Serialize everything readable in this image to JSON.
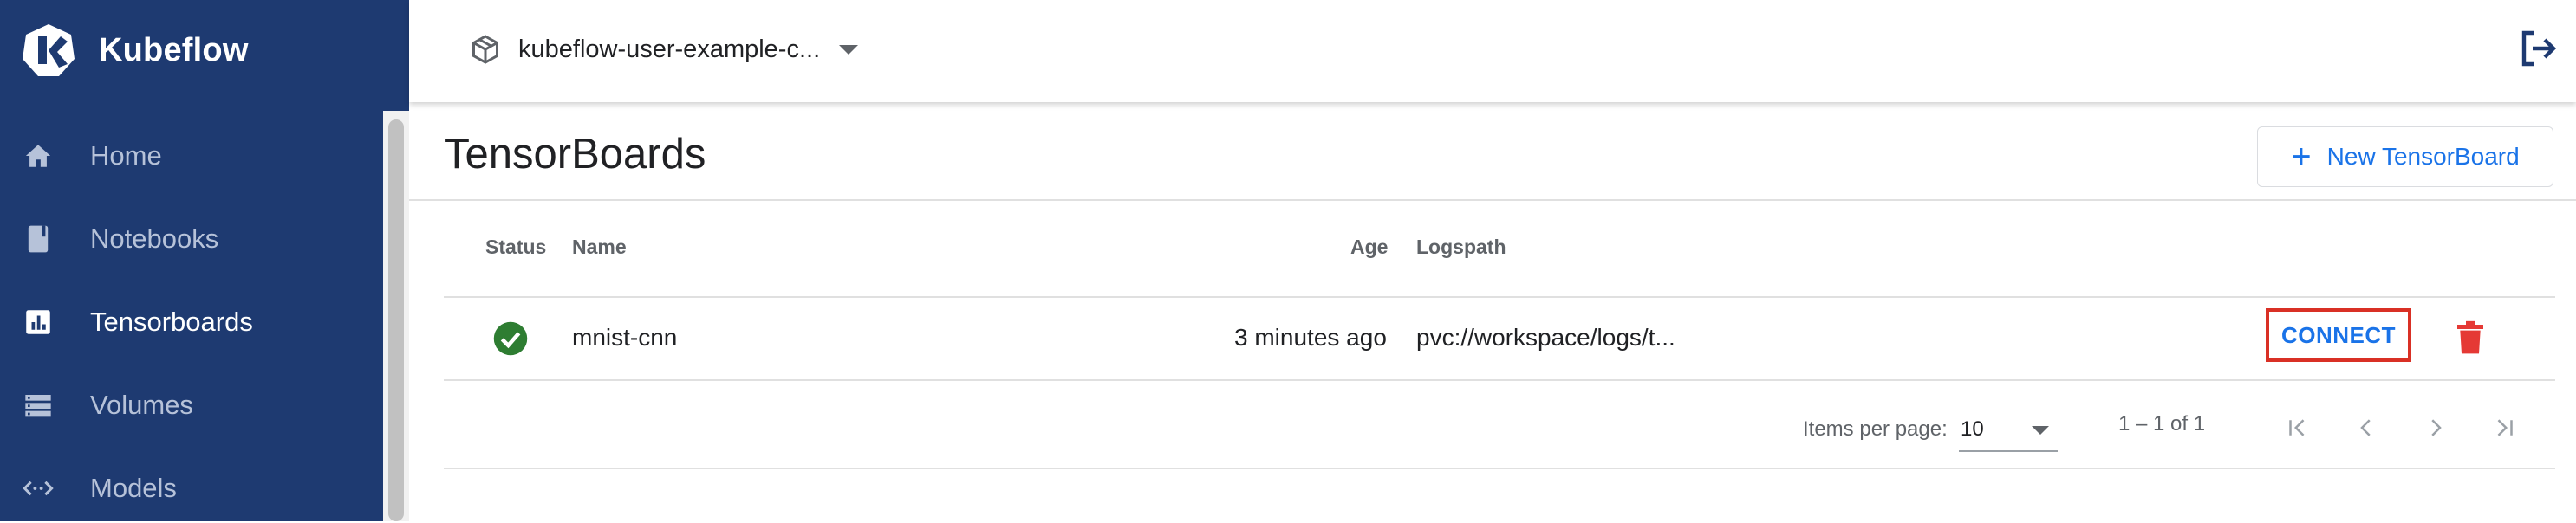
{
  "app": {
    "name": "Kubeflow"
  },
  "sidebar": {
    "items": [
      {
        "label": "Home",
        "icon": "home-icon",
        "active": false
      },
      {
        "label": "Notebooks",
        "icon": "notebook-icon",
        "active": false
      },
      {
        "label": "Tensorboards",
        "icon": "bar-chart-icon",
        "active": true
      },
      {
        "label": "Volumes",
        "icon": "storage-icon",
        "active": false
      },
      {
        "label": "Models",
        "icon": "code-arrows-icon",
        "active": false
      }
    ]
  },
  "topbar": {
    "namespace": "kubeflow-user-example-c...",
    "namespace_icon": "cube-icon",
    "logout_icon": "logout-icon"
  },
  "page": {
    "title": "TensorBoards",
    "new_button_label": "New TensorBoard"
  },
  "table": {
    "columns": {
      "status": "Status",
      "name": "Name",
      "age": "Age",
      "logspath": "Logspath"
    },
    "rows": [
      {
        "status": "ready",
        "name": "mnist-cnn",
        "age": "3 minutes ago",
        "logspath": "pvc://workspace/logs/t...",
        "action": "CONNECT"
      }
    ]
  },
  "pagination": {
    "items_per_page_label": "Items per page:",
    "items_per_page": "10",
    "range": "1 – 1 of 1"
  },
  "colors": {
    "sidebar_bg": "#1e3a71",
    "accent": "#1a73e8",
    "success": "#2e7d32",
    "danger": "#e53935",
    "highlight": "#d93025"
  }
}
